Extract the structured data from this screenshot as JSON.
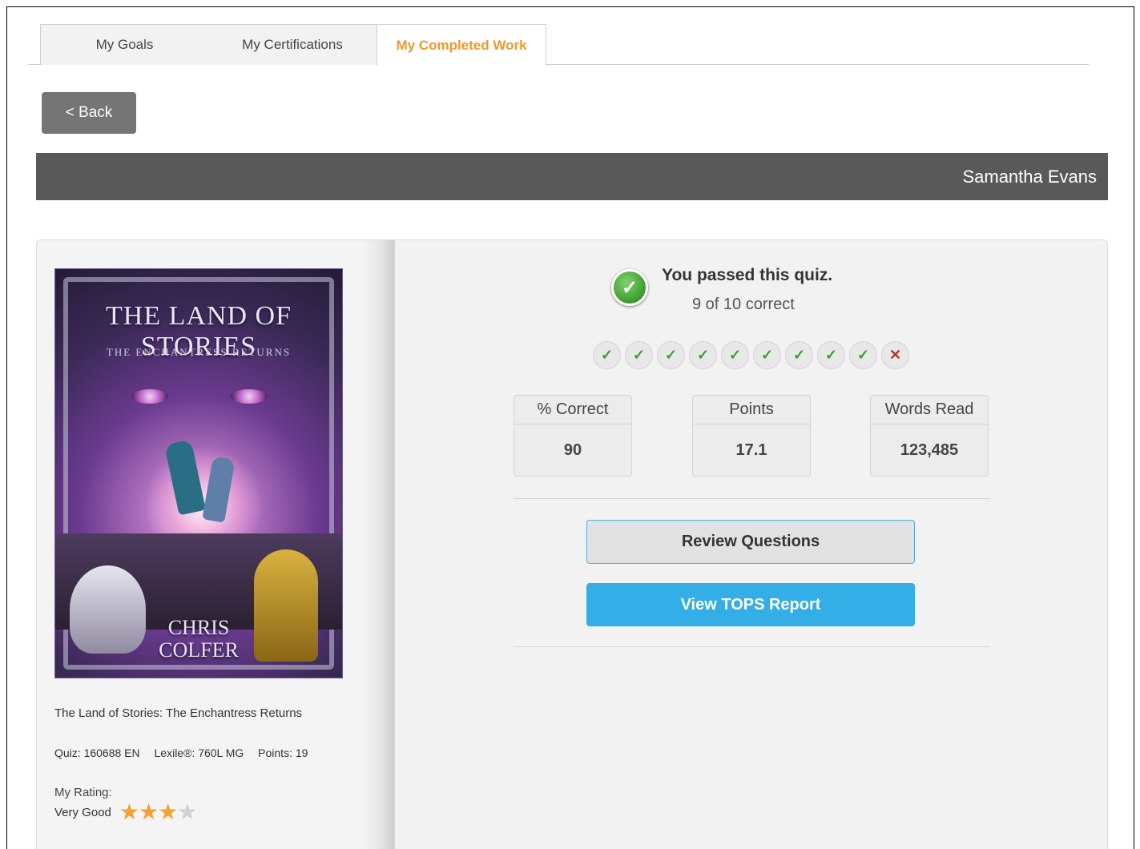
{
  "tabs": [
    {
      "label": "My Goals"
    },
    {
      "label": "My Certifications"
    },
    {
      "label": "My Completed Work"
    }
  ],
  "back_label": "< Back",
  "student_name": "Samantha Evans",
  "book": {
    "cover_title": "THE LAND OF STORIES",
    "cover_subtitle": "THE ENCHANTRESS RETURNS",
    "cover_author_line1": "CHRIS",
    "cover_author_line2": "COLFER",
    "title": "The Land of Stories: The Enchantress Returns",
    "quiz": "Quiz: 160688 EN",
    "lexile": "Lexile®: 760L MG",
    "points": "Points: 19",
    "rating_label": "My Rating:",
    "rating_text": "Very Good",
    "rating_stars": 3,
    "rating_max": 4
  },
  "result": {
    "title": "You passed this quiz.",
    "subtitle": "9 of 10 correct",
    "answers": [
      "correct",
      "correct",
      "correct",
      "correct",
      "correct",
      "correct",
      "correct",
      "correct",
      "correct",
      "incorrect"
    ]
  },
  "stats": [
    {
      "label": "% Correct",
      "value": "90"
    },
    {
      "label": "Points",
      "value": "17.1"
    },
    {
      "label": "Words Read",
      "value": "123,485"
    }
  ],
  "buttons": {
    "review": "Review Questions",
    "tops": "View TOPS Report"
  },
  "colors": {
    "active_tab": "#f0982d",
    "name_bar": "#595959",
    "tops_button": "#33aee6",
    "correct": "#3a9a2e",
    "incorrect": "#b0362c",
    "star_on": "#f5a033"
  }
}
